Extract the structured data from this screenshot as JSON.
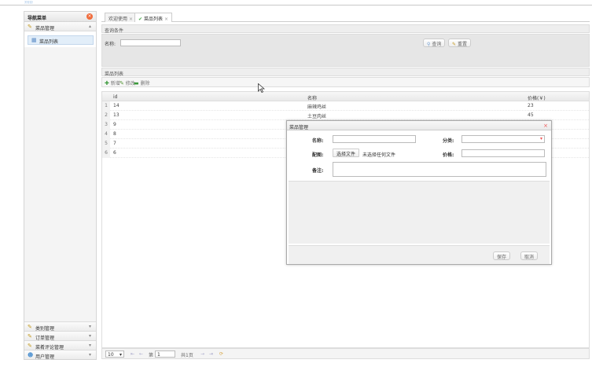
{
  "app": {
    "logo_text": "?????"
  },
  "sidebar": {
    "title": "导航菜单",
    "close": "×",
    "sections": [
      {
        "label": "菜品管理",
        "icon": "wrench-icon",
        "chevron": "▴",
        "expanded": true,
        "items": [
          {
            "label": "菜品列表",
            "icon": "list-icon"
          }
        ]
      }
    ],
    "bottom_sections": [
      {
        "label": "类别管理",
        "chevron": "▾"
      },
      {
        "label": "订单管理",
        "chevron": "▾"
      },
      {
        "label": "菜肴评论管理",
        "chevron": "▾"
      },
      {
        "label": "用户管理",
        "chevron": "▾"
      }
    ]
  },
  "tabs": [
    {
      "label": "欢迎使用",
      "close": "×"
    },
    {
      "label": "菜品列表",
      "close": "×",
      "check": "✔"
    }
  ],
  "search": {
    "header": "查询条件",
    "name_label": "名称:",
    "name_value": "",
    "query_label": "查询",
    "reset_label": "重置"
  },
  "list": {
    "header": "菜品列表",
    "add_label": "新增",
    "edit_label": "修改",
    "delete_label": "删除",
    "columns": {
      "id": "id",
      "name": "名称",
      "price": "价格(￥)"
    },
    "rows": [
      {
        "num": "1",
        "id": "14",
        "name": "麻辣鸡丝",
        "price": "23"
      },
      {
        "num": "2",
        "id": "13",
        "name": "土豆肉丝",
        "price": "45"
      },
      {
        "num": "3",
        "id": "9",
        "name": "",
        "price": ""
      },
      {
        "num": "4",
        "id": "8",
        "name": "",
        "price": ""
      },
      {
        "num": "5",
        "id": "7",
        "name": "",
        "price": ""
      },
      {
        "num": "6",
        "id": "6",
        "name": "",
        "price": ""
      }
    ]
  },
  "pager": {
    "page_size": "10",
    "page_size_arrow": "▾",
    "page_prefix": "第",
    "page_value": "1",
    "total_pages": "共1页",
    "nav_first": "⇤",
    "nav_prev": "←",
    "nav_next": "→",
    "nav_last": "⇥",
    "refresh": "⟳"
  },
  "dialog": {
    "title": "菜品管理",
    "close": "×",
    "name_label": "名称:",
    "category_label": "分类:",
    "category_arrow": "▾",
    "image_label": "配图:",
    "choose_file": "选择文件",
    "no_file": "未选择任何文件",
    "price_label": "价格:",
    "note_label": "备注:",
    "save_label": "保存",
    "cancel_label": "取消"
  },
  "colors": {
    "accent_blue": "#e2eef9",
    "close_red": "#f06b3b",
    "check_green": "#4aa84a"
  }
}
